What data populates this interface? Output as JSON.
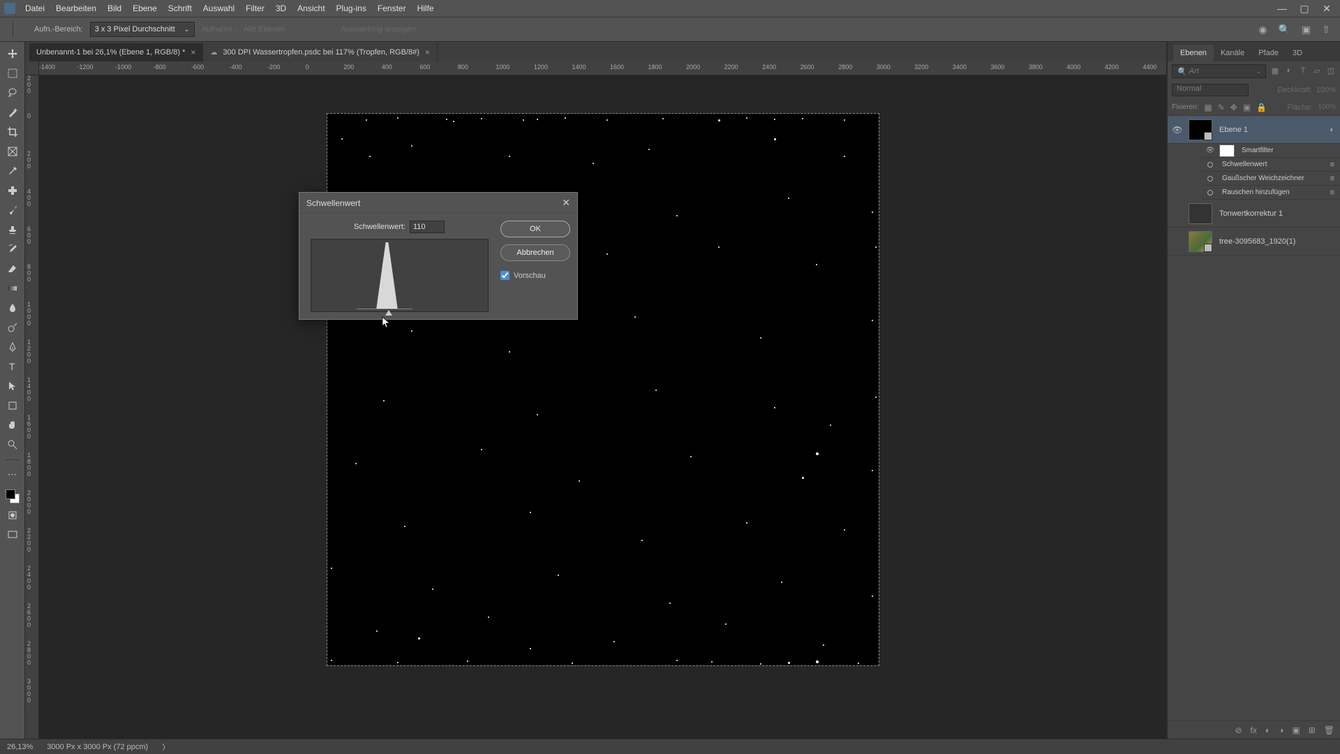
{
  "menubar": {
    "items": [
      "Datei",
      "Bearbeiten",
      "Bild",
      "Ebene",
      "Schrift",
      "Auswahl",
      "Filter",
      "3D",
      "Ansicht",
      "Plug-ins",
      "Fenster",
      "Hilfe"
    ]
  },
  "optionsbar": {
    "sample_label": "Aufn.-Bereich:",
    "sample_value": "3 x 3 Pixel Durchschnitt",
    "layers_label": "Aufnahm.:",
    "layers_value": "Alle Ebenen",
    "show_selection": "Auswahlring anzeigen"
  },
  "tabs": [
    {
      "label": "Unbenannt-1 bei 26,1% (Ebene 1, RGB/8) *"
    },
    {
      "label": "300 DPI Wassertropfen.psdc bei 117% (Tropfen, RGB/8#)"
    }
  ],
  "ruler_h": [
    "-1400",
    "-1200",
    "-1000",
    "-800",
    "-600",
    "-400",
    "-200",
    "0",
    "200",
    "400",
    "600",
    "800",
    "1000",
    "1200",
    "1400",
    "1600",
    "1800",
    "2000",
    "2200",
    "2400",
    "2600",
    "2800",
    "3000",
    "3200",
    "3400",
    "3600",
    "3800",
    "4000",
    "4200",
    "4400"
  ],
  "ruler_v": [
    "2\n0\n0",
    "0",
    "2\n0\n0",
    "4\n0\n0",
    "6\n0\n0",
    "8\n0\n0",
    "1\n0\n0\n0",
    "1\n2\n0\n0",
    "1\n4\n0\n0",
    "1\n6\n0\n0",
    "1\n8\n0\n0",
    "2\n0\n0\n0",
    "2\n2\n0\n0",
    "2\n4\n0\n0",
    "2\n6\n0\n0",
    "2\n8\n0\n0",
    "3\n0\n0\n0"
  ],
  "dialog": {
    "title": "Schwellenwert",
    "field_label": "Schwellenwert:",
    "field_value": "110",
    "ok": "OK",
    "cancel": "Abbrechen",
    "preview": "Vorschau"
  },
  "statusbar": {
    "zoom": "26,13%",
    "doc": "3000 Px x 3000 Px (72 ppcm)"
  },
  "panels": {
    "tabs": [
      "Ebenen",
      "Kanäle",
      "Pfade",
      "3D"
    ],
    "search_placeholder": "Art",
    "blend_mode": "Normal",
    "opacity_label": "Deckkraft:",
    "opacity_value": "100%",
    "lock_label": "Fixieren:",
    "fill_label": "Fläche:",
    "fill_value": "100%",
    "layers": [
      {
        "eye": true,
        "selected": true,
        "thumb": "black",
        "name": "Ebene 1",
        "smart": true
      },
      {
        "sub_header": "Smartfilter"
      },
      {
        "sub_filter": "Schwellenwert"
      },
      {
        "sub_filter": "Gaußscher Weichzeichner"
      },
      {
        "sub_filter": "Rauschen hinzufügen"
      },
      {
        "eye": false,
        "thumb": "adj",
        "name": "Tonwertkorrektur 1"
      },
      {
        "eye": false,
        "thumb": "colorful",
        "name": "tree-3095683_1920(1)"
      }
    ]
  }
}
